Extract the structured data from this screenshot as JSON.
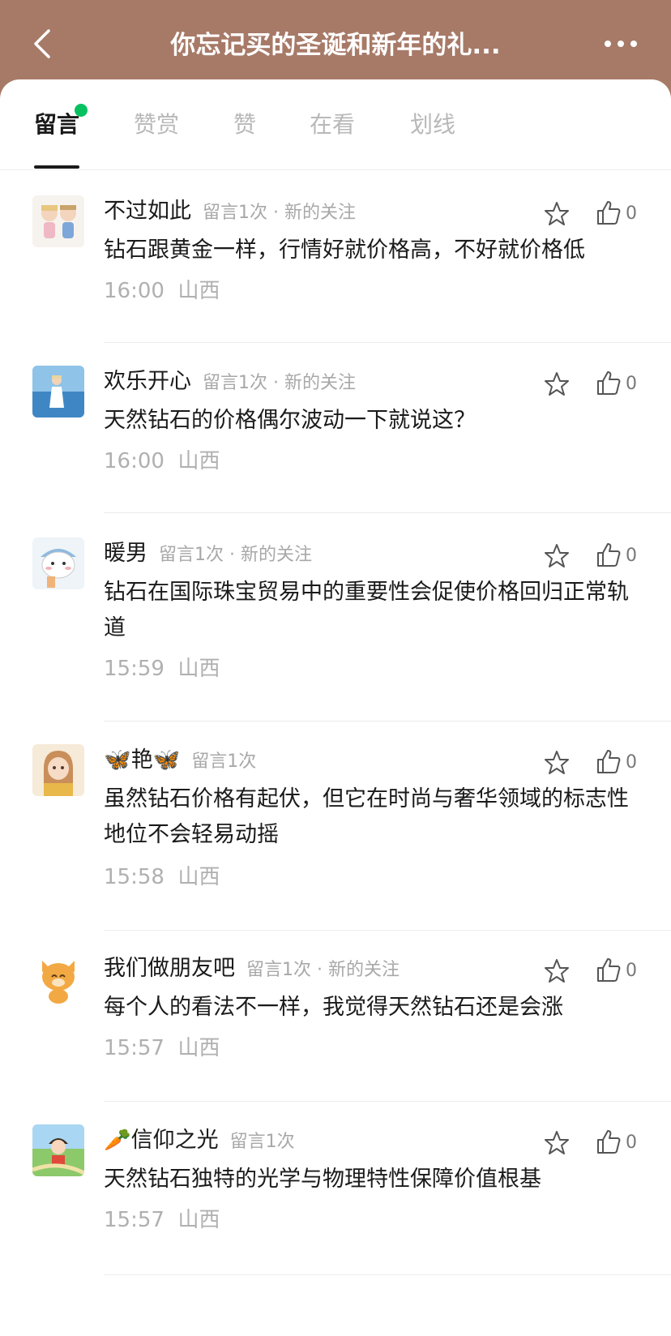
{
  "header": {
    "title": "你忘记买的圣诞和新年的礼...",
    "back_icon": "back-chevron-icon",
    "more_icon": "more-dots-icon",
    "bg_color": "#a77a68"
  },
  "tabs": [
    {
      "label": "留言",
      "active": true,
      "has_dot": true
    },
    {
      "label": "赞赏",
      "active": false
    },
    {
      "label": "赞",
      "active": false
    },
    {
      "label": "在看",
      "active": false
    },
    {
      "label": "划线",
      "active": false
    }
  ],
  "accent_color": "#07c160",
  "comments": [
    {
      "nickname": "不过如此",
      "meta": "留言1次 · 新的关注",
      "content": "钻石跟黄金一样，行情好就价格高，不好就价格低",
      "time": "16:00",
      "location": "山西",
      "likes": "0",
      "avatar": "couple-cartoon-avatar"
    },
    {
      "nickname": "欢乐开心",
      "meta": "留言1次 · 新的关注",
      "content": "天然钻石的价格偶尔波动一下就说这？",
      "time": "16:00",
      "location": "山西",
      "likes": "0",
      "avatar": "beach-photo-avatar"
    },
    {
      "nickname": "暖男",
      "meta": "留言1次 · 新的关注",
      "content": "钻石在国际珠宝贸易中的重要性会促使价格回归正常轨道",
      "time": "15:59",
      "location": "山西",
      "likes": "0",
      "avatar": "bear-cartoon-avatar"
    },
    {
      "nickname": "🦋艳🦋",
      "meta": "留言1次",
      "content": "虽然钻石价格有起伏，但它在时尚与奢华领域的标志性地位不会轻易动摇",
      "time": "15:58",
      "location": "山西",
      "likes": "0",
      "avatar": "girl-illustration-avatar"
    },
    {
      "nickname": "我们做朋友吧",
      "meta": "留言1次 · 新的关注",
      "content": "每个人的看法不一样，我觉得天然钻石还是会涨",
      "time": "15:57",
      "location": "山西",
      "likes": "0",
      "avatar": "tiger-cat-avatar"
    },
    {
      "nickname": "🥕信仰之光",
      "meta": "留言1次",
      "content": "天然钻石独特的光学与物理特性保障价值根基",
      "time": "15:57",
      "location": "山西",
      "likes": "0",
      "avatar": "child-field-avatar"
    }
  ]
}
